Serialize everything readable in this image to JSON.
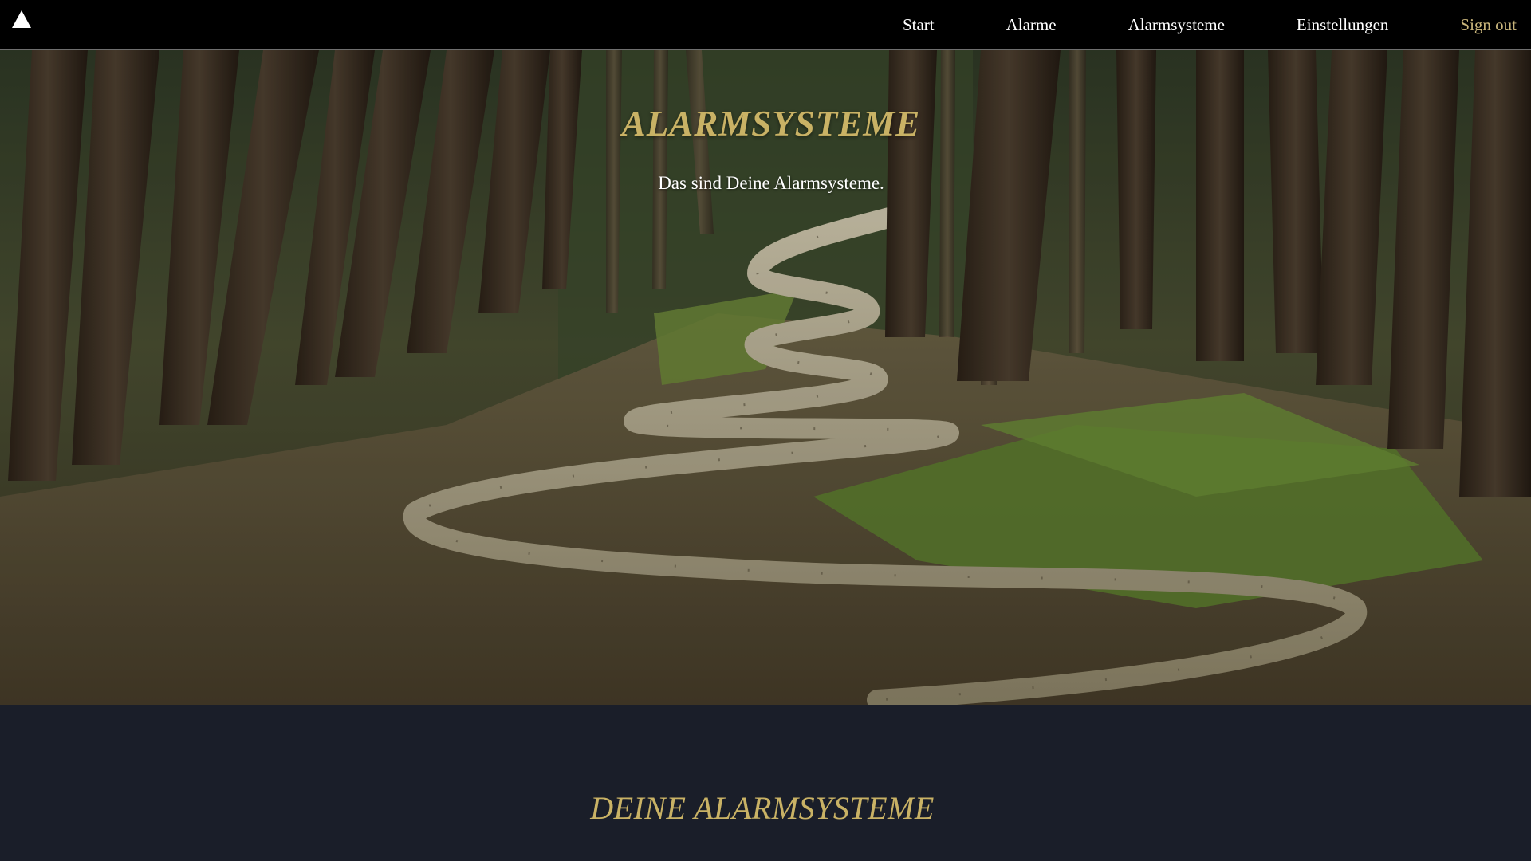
{
  "nav": {
    "logo_icon": "triangle-logo-icon",
    "links": [
      {
        "label": "Start"
      },
      {
        "label": "Alarme"
      },
      {
        "label": "Alarmsysteme"
      },
      {
        "label": "Einstellungen"
      }
    ],
    "signout": "Sign out",
    "colors": {
      "bar": "#000000",
      "link": "#ffffff",
      "signout": "#c9b57b"
    }
  },
  "hero": {
    "title": "ALARMSYSTEME",
    "subtitle": "Das sind Deine Alarmsysteme.",
    "background": "forest-path-photo",
    "colors": {
      "title": "#c9b265",
      "subtitle": "#ffffff"
    }
  },
  "section": {
    "title": "DEINE ALARMSYSTEME",
    "colors": {
      "background": "#1a1e29",
      "title": "#c9b265"
    }
  }
}
